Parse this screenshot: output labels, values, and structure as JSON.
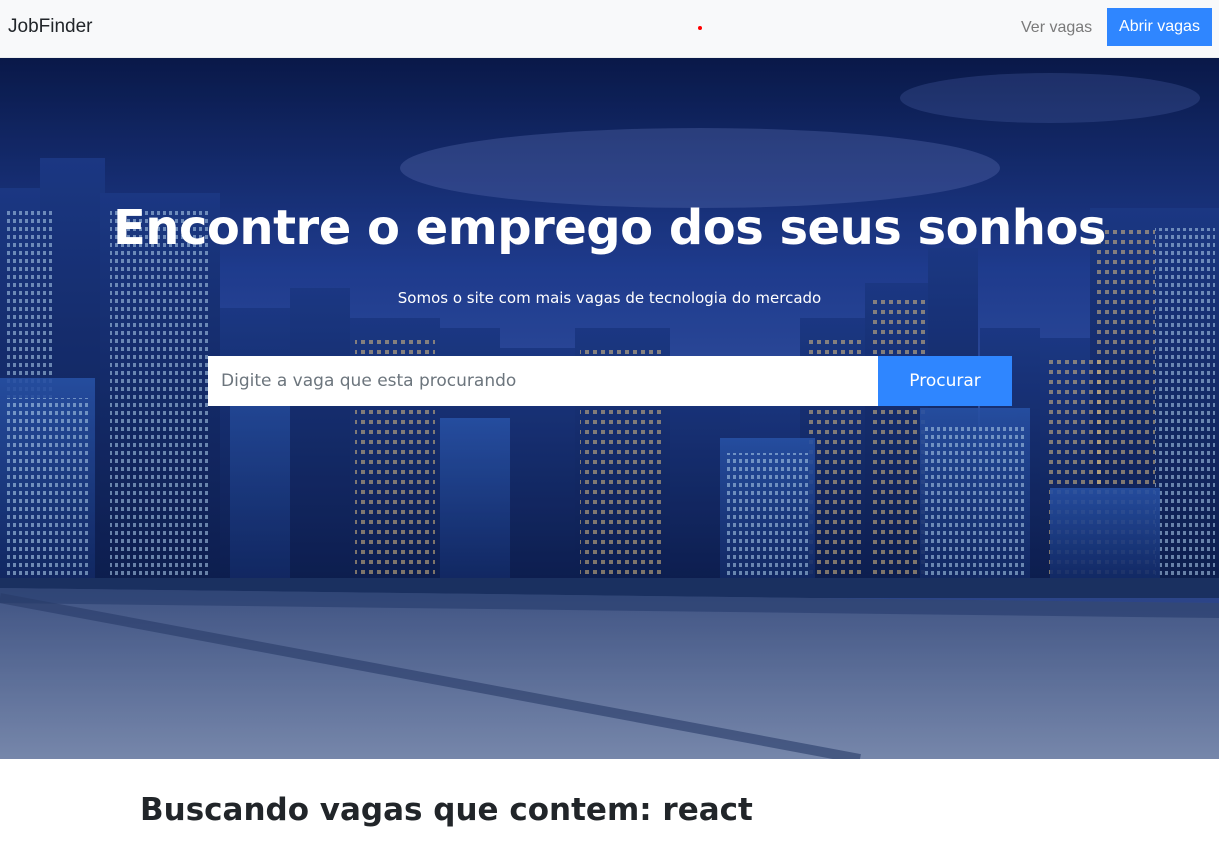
{
  "navbar": {
    "brand": "JobFinder",
    "link_label": "Ver vagas",
    "button_label": "Abrir vagas",
    "accent_color": "#2f86ff"
  },
  "hero": {
    "title": "Encontre o emprego dos seus sonhos",
    "subtitle": "Somos o site com mais vagas de tecnologia do mercado",
    "search": {
      "placeholder": "Digite a vaga que esta procurando",
      "value": "",
      "button_label": "Procurar"
    },
    "background": "night-city-skyline"
  },
  "results": {
    "heading": "Buscando vagas que contem: react"
  }
}
